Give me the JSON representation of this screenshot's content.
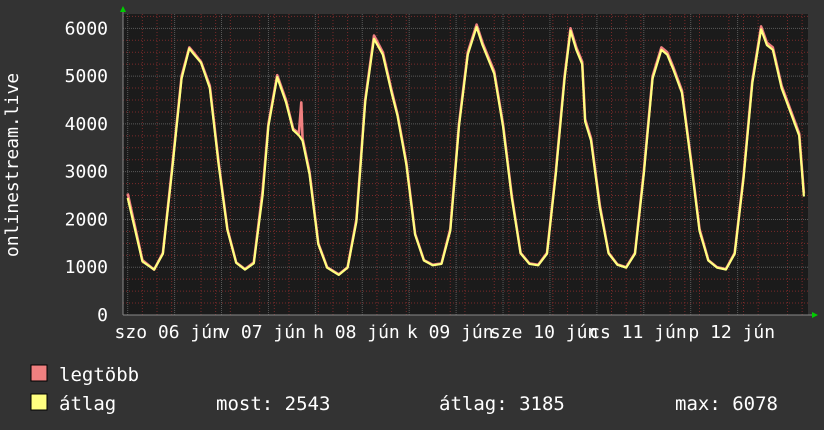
{
  "chart_data": {
    "type": "line",
    "ylabel": "onlinestream.live",
    "ylim": [
      0,
      6300
    ],
    "y_ticks": [
      0,
      1000,
      2000,
      3000,
      4000,
      5000,
      6000
    ],
    "x_ticks": [
      "szo 06 jún",
      "v 07 jún",
      "h 08 jún",
      "k 09 jún",
      "sze 10 jún",
      "cs 11 jún",
      "p 12 jún"
    ],
    "grid": true,
    "colors": {
      "background": "#333333",
      "plot_background": "#1b1b1b",
      "grid_major": "#5a5a5a",
      "grid_minor": "#7a2a2a",
      "axis": "#888888",
      "arrow": "#00cc00",
      "max_series": "#f08080",
      "avg_series": "#ffff80"
    },
    "days": 7,
    "daily_peaks": [
      5600,
      5020,
      5850,
      6078,
      6000,
      5620,
      6040
    ],
    "daily_minima": [
      950,
      920,
      850,
      1050,
      1050,
      1000,
      960
    ],
    "series": [
      {
        "name": "legtöbb",
        "points": [
          [
            0.0,
            2543
          ],
          [
            0.25,
            1150
          ],
          [
            0.45,
            950
          ],
          [
            0.6,
            1300
          ],
          [
            0.75,
            3000
          ],
          [
            0.92,
            5000
          ],
          [
            1.05,
            5600
          ],
          [
            1.12,
            5500
          ],
          [
            1.25,
            5300
          ],
          [
            1.4,
            4800
          ],
          [
            1.55,
            3200
          ],
          [
            1.7,
            1800
          ],
          [
            1.85,
            1100
          ],
          [
            2.0,
            960
          ],
          [
            2.15,
            1100
          ],
          [
            2.3,
            2600
          ],
          [
            2.4,
            4000
          ],
          [
            2.55,
            5020
          ],
          [
            2.7,
            4500
          ],
          [
            2.82,
            3900
          ],
          [
            2.92,
            3800
          ],
          [
            2.96,
            4450
          ],
          [
            2.98,
            3700
          ],
          [
            3.1,
            3000
          ],
          [
            3.25,
            1500
          ],
          [
            3.4,
            1000
          ],
          [
            3.6,
            850
          ],
          [
            3.75,
            1000
          ],
          [
            3.9,
            2000
          ],
          [
            4.05,
            4500
          ],
          [
            4.2,
            5850
          ],
          [
            4.35,
            5500
          ],
          [
            4.5,
            4700
          ],
          [
            4.6,
            4200
          ],
          [
            4.75,
            3200
          ],
          [
            4.9,
            1700
          ],
          [
            5.05,
            1150
          ],
          [
            5.2,
            1050
          ],
          [
            5.35,
            1080
          ],
          [
            5.5,
            1800
          ],
          [
            5.65,
            4000
          ],
          [
            5.8,
            5500
          ],
          [
            5.95,
            6078
          ],
          [
            6.05,
            5700
          ],
          [
            6.25,
            5100
          ],
          [
            6.4,
            4000
          ],
          [
            6.55,
            2500
          ],
          [
            6.7,
            1300
          ],
          [
            6.85,
            1080
          ],
          [
            7.0,
            1050
          ],
          [
            7.15,
            1300
          ],
          [
            7.3,
            3000
          ],
          [
            7.45,
            5000
          ],
          [
            7.55,
            6000
          ],
          [
            7.65,
            5600
          ],
          [
            7.75,
            5300
          ],
          [
            7.8,
            4100
          ],
          [
            7.9,
            3700
          ],
          [
            8.05,
            2300
          ],
          [
            8.2,
            1300
          ],
          [
            8.35,
            1060
          ],
          [
            8.5,
            1000
          ],
          [
            8.65,
            1300
          ],
          [
            8.8,
            3000
          ],
          [
            8.95,
            5000
          ],
          [
            9.1,
            5600
          ],
          [
            9.2,
            5500
          ],
          [
            9.3,
            5200
          ],
          [
            9.45,
            4700
          ],
          [
            9.6,
            3300
          ],
          [
            9.75,
            1800
          ],
          [
            9.9,
            1150
          ],
          [
            10.05,
            1000
          ],
          [
            10.2,
            960
          ],
          [
            10.35,
            1300
          ],
          [
            10.5,
            2900
          ],
          [
            10.65,
            4900
          ],
          [
            10.8,
            6040
          ],
          [
            10.9,
            5700
          ],
          [
            11.0,
            5600
          ],
          [
            11.15,
            4800
          ],
          [
            11.3,
            4300
          ],
          [
            11.45,
            3800
          ],
          [
            11.53,
            2543
          ]
        ]
      },
      {
        "name": "átlag",
        "points": [
          [
            0.0,
            2450
          ],
          [
            0.25,
            1120
          ],
          [
            0.45,
            950
          ],
          [
            0.6,
            1280
          ],
          [
            0.75,
            2950
          ],
          [
            0.92,
            4950
          ],
          [
            1.05,
            5580
          ],
          [
            1.12,
            5470
          ],
          [
            1.25,
            5280
          ],
          [
            1.4,
            4750
          ],
          [
            1.55,
            3150
          ],
          [
            1.7,
            1780
          ],
          [
            1.85,
            1090
          ],
          [
            2.0,
            950
          ],
          [
            2.15,
            1080
          ],
          [
            2.3,
            2500
          ],
          [
            2.4,
            3950
          ],
          [
            2.55,
            4980
          ],
          [
            2.7,
            4450
          ],
          [
            2.82,
            3870
          ],
          [
            2.92,
            3760
          ],
          [
            2.98,
            3650
          ],
          [
            3.1,
            2950
          ],
          [
            3.25,
            1480
          ],
          [
            3.4,
            990
          ],
          [
            3.6,
            840
          ],
          [
            3.75,
            990
          ],
          [
            3.9,
            1950
          ],
          [
            4.05,
            4450
          ],
          [
            4.2,
            5780
          ],
          [
            4.35,
            5450
          ],
          [
            4.5,
            4650
          ],
          [
            4.6,
            4170
          ],
          [
            4.75,
            3150
          ],
          [
            4.9,
            1680
          ],
          [
            5.05,
            1140
          ],
          [
            5.2,
            1040
          ],
          [
            5.35,
            1070
          ],
          [
            5.5,
            1760
          ],
          [
            5.65,
            3950
          ],
          [
            5.8,
            5450
          ],
          [
            5.95,
            6030
          ],
          [
            6.05,
            5650
          ],
          [
            6.25,
            5050
          ],
          [
            6.4,
            3950
          ],
          [
            6.55,
            2450
          ],
          [
            6.7,
            1290
          ],
          [
            6.85,
            1070
          ],
          [
            7.0,
            1040
          ],
          [
            7.15,
            1280
          ],
          [
            7.3,
            2950
          ],
          [
            7.45,
            4950
          ],
          [
            7.55,
            5950
          ],
          [
            7.65,
            5550
          ],
          [
            7.75,
            5250
          ],
          [
            7.8,
            4050
          ],
          [
            7.9,
            3650
          ],
          [
            8.05,
            2250
          ],
          [
            8.2,
            1290
          ],
          [
            8.35,
            1050
          ],
          [
            8.5,
            990
          ],
          [
            8.65,
            1280
          ],
          [
            8.8,
            2950
          ],
          [
            8.95,
            4950
          ],
          [
            9.1,
            5550
          ],
          [
            9.2,
            5450
          ],
          [
            9.3,
            5150
          ],
          [
            9.45,
            4650
          ],
          [
            9.6,
            3250
          ],
          [
            9.75,
            1760
          ],
          [
            9.9,
            1140
          ],
          [
            10.05,
            990
          ],
          [
            10.2,
            950
          ],
          [
            10.35,
            1280
          ],
          [
            10.5,
            2850
          ],
          [
            10.65,
            4850
          ],
          [
            10.8,
            5980
          ],
          [
            10.9,
            5650
          ],
          [
            11.0,
            5550
          ],
          [
            11.15,
            4750
          ],
          [
            11.3,
            4250
          ],
          [
            11.45,
            3750
          ],
          [
            11.53,
            2480
          ]
        ]
      }
    ],
    "x_domain": [
      -0.08,
      11.6
    ]
  },
  "legend": {
    "max_label": "legtöbb",
    "avg_label": "átlag",
    "now_text": "most: 2543",
    "avg_text": "átlag: 3185",
    "max_text": "max: 6078"
  }
}
